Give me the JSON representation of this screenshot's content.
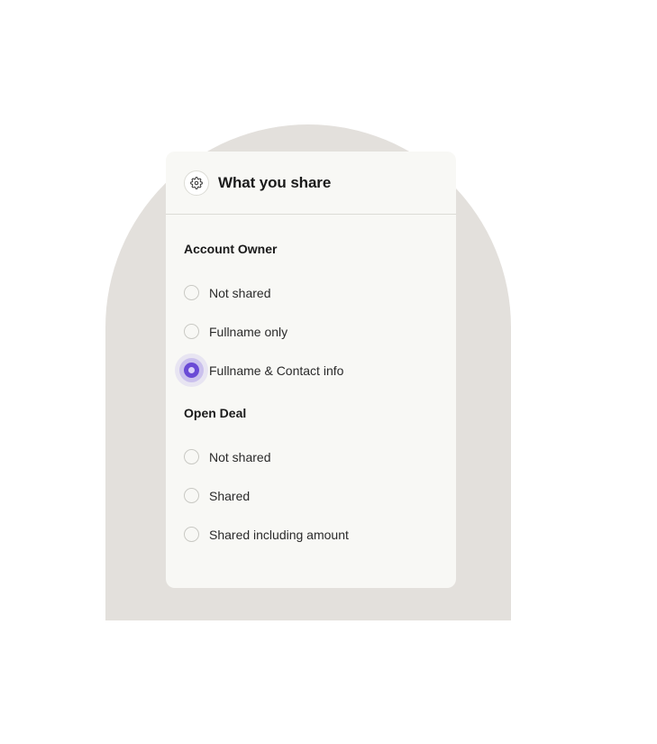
{
  "card": {
    "title": "What you share",
    "header_icon": "gear-icon"
  },
  "sections": [
    {
      "title": "Account Owner",
      "options": [
        {
          "label": "Not shared",
          "selected": false
        },
        {
          "label": "Fullname only",
          "selected": false
        },
        {
          "label": "Fullname & Contact info",
          "selected": true
        }
      ]
    },
    {
      "title": "Open Deal",
      "options": [
        {
          "label": "Not shared",
          "selected": false
        },
        {
          "label": "Shared",
          "selected": false
        },
        {
          "label": "Shared including amount",
          "selected": false
        }
      ]
    }
  ],
  "colors": {
    "accent": "#6a4ad6",
    "background_arch": "#e3e0dc",
    "card_background": "#f8f8f5"
  }
}
